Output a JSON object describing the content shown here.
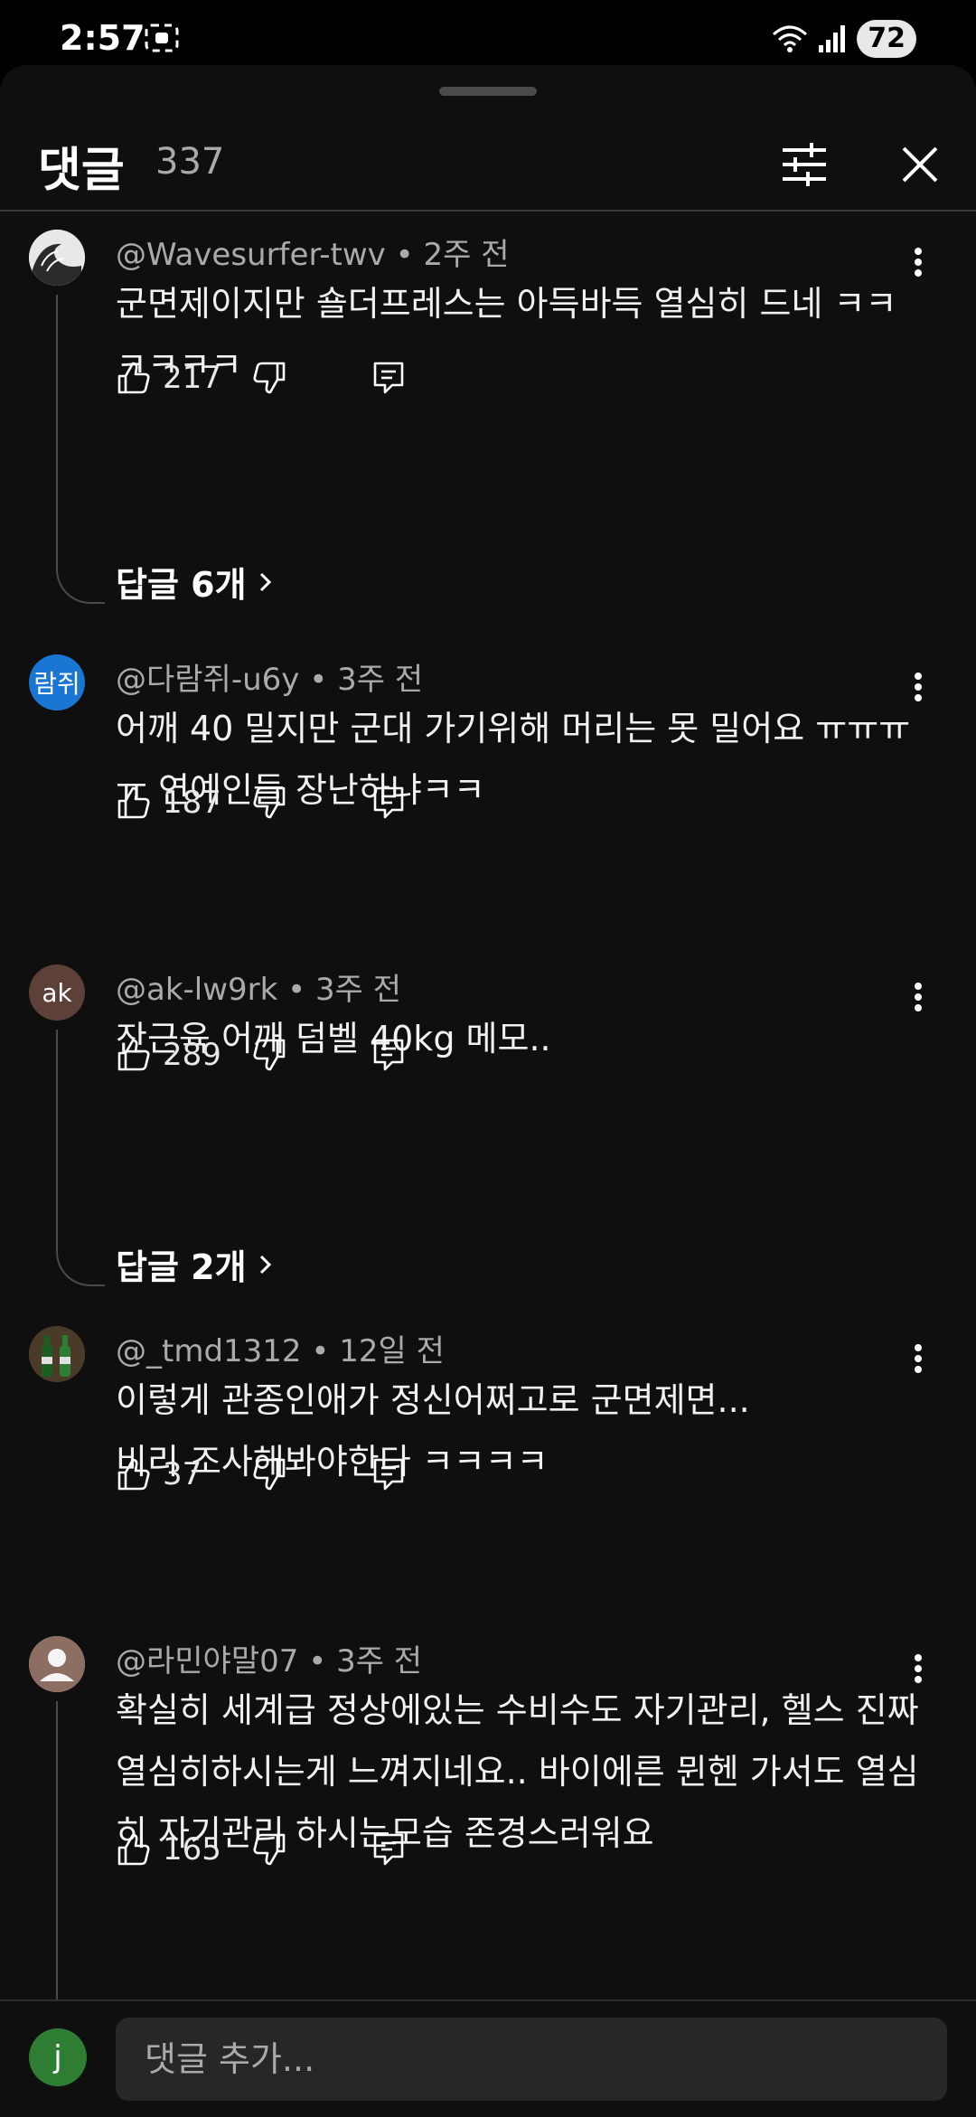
{
  "status_bar": {
    "time": "2:57",
    "battery": "72"
  },
  "header": {
    "title": "댓글",
    "count": "337"
  },
  "comments": [
    {
      "author": "@Wavesurfer-twv",
      "time": "2주 전",
      "text": "군면제이지만 숄더프레스는 아득바득 열심히 드네 ㅋㅋㅋㅋㅋㅋ",
      "likes": "217",
      "replies_label": "답글 6개",
      "avatar_text": ""
    },
    {
      "author": "@다람쥐-u6y",
      "time": "3주 전",
      "text": "어깨 40 밀지만 군대 가기위해 머리는 못 밀어요 ㅠㅠㅠㅠ 연예인들 장난하냐ㅋㅋ",
      "likes": "187",
      "avatar_text": "람쥐"
    },
    {
      "author": "@ak-lw9rk",
      "time": "3주 전",
      "text": "잔근육 어깨 덤벨 40kg 메모..",
      "likes": "289",
      "replies_label": "답글 2개",
      "avatar_text": "ak"
    },
    {
      "author": "@_tmd1312",
      "time": "12일 전",
      "text": "이렇게 관종인애가 정신어쩌고로 군면제면...\n비리 조사해봐야한다 ㅋㅋㅋㅋ",
      "likes": "37",
      "avatar_text": ""
    },
    {
      "author": "@라민야말07",
      "time": "3주 전",
      "text": "확실히 세계급 정상에있는 수비수도 자기관리, 헬스 진짜 열심히하시는게 느껴지네요.. 바이에른 뮌헨 가서도 열심히 자기관리 하시는모습 존경스러워요",
      "likes": "165",
      "avatar_text": ""
    }
  ],
  "composer": {
    "placeholder": "댓글 추가...",
    "avatar_text": "j"
  },
  "colors": {
    "sheet_bg": "#0f0f0f",
    "secondary_text": "#aaaaaa",
    "avatar_blue": "#1976d2",
    "avatar_brown": "#5d4037"
  }
}
